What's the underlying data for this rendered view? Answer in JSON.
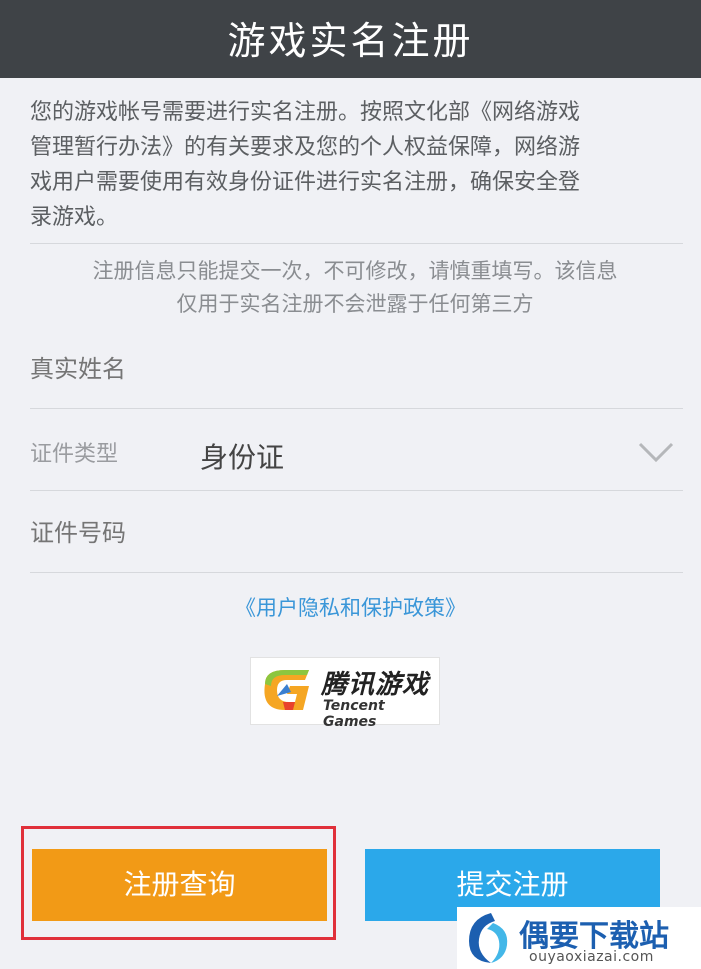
{
  "header": {
    "title": "游戏实名注册"
  },
  "intro": {
    "lines": [
      "您的游戏帐号需要进行实名注册。按照文化部《网络游戏",
      "管理暂行办法》的有关要求及您的个人权益保障，网络游",
      "戏用户需要使用有效身份证件进行实名注册，确保安全登",
      "录游戏。"
    ]
  },
  "notice": {
    "lines": [
      "注册信息只能提交一次，不可修改，请慎重填写。该信息",
      "仅用于实名注册不会泄露于任何第三方"
    ]
  },
  "form": {
    "name_placeholder": "真实姓名",
    "id_type_label": "证件类型",
    "id_type_value": "身份证",
    "id_number_placeholder": "证件号码"
  },
  "policy_link": "《用户隐私和保护政策》",
  "logo": {
    "cn": "腾讯游戏",
    "en": "Tencent Games"
  },
  "buttons": {
    "query": "注册查询",
    "submit": "提交注册"
  },
  "watermark": {
    "cn": "偶要下载站",
    "en": "ouyaoxiazai.com"
  },
  "colors": {
    "header_bg": "#3f4347",
    "query_button": "#f29a16",
    "submit_button": "#2ba8ea",
    "link": "#3a96d8",
    "highlight": "#e0303a"
  }
}
